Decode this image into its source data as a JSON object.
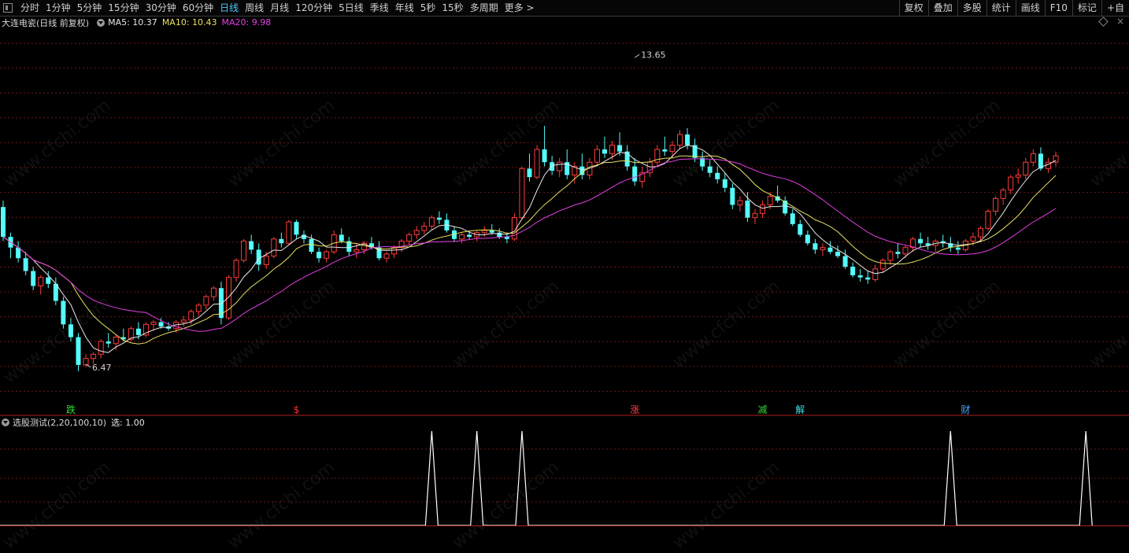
{
  "toolbar": {
    "periods": [
      "分时",
      "1分钟",
      "5分钟",
      "15分钟",
      "30分钟",
      "60分钟",
      "日线",
      "周线",
      "月线",
      "120分钟",
      "5日线",
      "季线",
      "年线",
      "5秒",
      "15秒",
      "多周期",
      "更多 >"
    ],
    "active_period": "日线",
    "right_buttons": [
      "复权",
      "叠加",
      "多股",
      "统计",
      "画线",
      "F10",
      "标记",
      "+自"
    ]
  },
  "main_header": {
    "title": "大连电瓷(日线 前复权)",
    "ma5": "MA5: 10.37",
    "ma10": "MA10: 10.43",
    "ma20": "MA20: 9.98"
  },
  "sub_header": {
    "title": "选股测试(2,20,100,10)",
    "value": "选: 1.00"
  },
  "watermark": "www.cfchi.com",
  "colors": {
    "up": "#ff3c3c",
    "down": "#54fcfc",
    "ma5": "#e8e8e8",
    "ma10": "#e8e060",
    "ma20": "#e040e0",
    "grid": "#6a1818",
    "signal": "#ffffff",
    "background": "#000000",
    "active": "#4ec9ff"
  },
  "chart_data": [
    {
      "type": "candlestick",
      "n": 146,
      "ylim": [
        5.6,
        14.3
      ],
      "annotations": [
        {
          "text": "13.65",
          "index": 84,
          "value": 13.65
        },
        {
          "text": "6.47",
          "index": 11,
          "value": 6.47
        }
      ],
      "markers": [
        {
          "text": "跌",
          "index": 9,
          "color": "#33dd33"
        },
        {
          "text": "$",
          "index": 39,
          "color": "#ff3030"
        },
        {
          "text": "涨",
          "index": 84,
          "color": "#ff4040"
        },
        {
          "text": "减",
          "index": 101,
          "color": "#33dd33"
        },
        {
          "text": "解",
          "index": 106,
          "color": "#40e0e0"
        },
        {
          "text": "财",
          "index": 128,
          "color": "#4aa8ff"
        }
      ],
      "ohlc": [
        [
          10.15,
          10.3,
          9.35,
          9.45
        ],
        [
          9.45,
          9.55,
          8.95,
          9.2
        ],
        [
          9.2,
          9.35,
          8.85,
          8.95
        ],
        [
          8.95,
          9.1,
          8.55,
          8.65
        ],
        [
          8.65,
          8.75,
          8.2,
          8.3
        ],
        [
          8.3,
          8.55,
          8.1,
          8.5
        ],
        [
          8.5,
          8.65,
          8.25,
          8.35
        ],
        [
          8.35,
          8.5,
          7.85,
          7.95
        ],
        [
          7.95,
          8.05,
          7.3,
          7.4
        ],
        [
          7.4,
          7.55,
          7.0,
          7.1
        ],
        [
          7.1,
          7.2,
          6.3,
          6.45
        ],
        [
          6.45,
          6.7,
          6.4,
          6.6
        ],
        [
          6.6,
          6.75,
          6.47,
          6.7
        ],
        [
          6.7,
          7.05,
          6.6,
          7.0
        ],
        [
          7.0,
          7.2,
          6.85,
          6.95
        ],
        [
          6.95,
          7.15,
          6.8,
          7.1
        ],
        [
          7.1,
          7.3,
          7.0,
          7.05
        ],
        [
          7.05,
          7.35,
          7.0,
          7.3
        ],
        [
          7.3,
          7.45,
          7.05,
          7.15
        ],
        [
          7.15,
          7.45,
          7.1,
          7.4
        ],
        [
          7.4,
          7.5,
          7.25,
          7.45
        ],
        [
          7.45,
          7.55,
          7.3,
          7.35
        ],
        [
          7.35,
          7.45,
          7.25,
          7.3
        ],
        [
          7.3,
          7.5,
          7.2,
          7.45
        ],
        [
          7.45,
          7.6,
          7.35,
          7.5
        ],
        [
          7.5,
          7.75,
          7.4,
          7.7
        ],
        [
          7.7,
          7.9,
          7.6,
          7.85
        ],
        [
          7.85,
          8.1,
          7.75,
          8.05
        ],
        [
          8.05,
          8.3,
          7.95,
          8.25
        ],
        [
          8.25,
          8.4,
          7.4,
          7.55
        ],
        [
          7.55,
          8.55,
          7.5,
          8.5
        ],
        [
          8.5,
          8.95,
          8.4,
          8.9
        ],
        [
          8.9,
          9.4,
          8.85,
          9.35
        ],
        [
          9.35,
          9.5,
          9.05,
          9.15
        ],
        [
          9.15,
          9.3,
          8.65,
          8.8
        ],
        [
          8.8,
          9.1,
          8.7,
          9.0
        ],
        [
          9.0,
          9.45,
          8.95,
          9.4
        ],
        [
          9.4,
          9.55,
          9.2,
          9.3
        ],
        [
          9.3,
          9.85,
          9.25,
          9.8
        ],
        [
          9.8,
          9.85,
          9.4,
          9.5
        ],
        [
          9.5,
          9.6,
          9.3,
          9.4
        ],
        [
          9.4,
          9.5,
          9.05,
          9.1
        ],
        [
          9.1,
          9.2,
          8.85,
          8.95
        ],
        [
          8.95,
          9.15,
          8.85,
          9.1
        ],
        [
          9.1,
          9.6,
          9.05,
          9.5
        ],
        [
          9.5,
          9.65,
          9.3,
          9.35
        ],
        [
          9.35,
          9.45,
          9.0,
          9.1
        ],
        [
          9.1,
          9.3,
          8.95,
          9.15
        ],
        [
          9.15,
          9.35,
          9.05,
          9.3
        ],
        [
          9.3,
          9.45,
          9.15,
          9.2
        ],
        [
          9.2,
          9.35,
          8.9,
          8.95
        ],
        [
          8.95,
          9.1,
          8.85,
          9.05
        ],
        [
          9.05,
          9.25,
          8.95,
          9.2
        ],
        [
          9.2,
          9.4,
          9.1,
          9.35
        ],
        [
          9.35,
          9.55,
          9.25,
          9.5
        ],
        [
          9.5,
          9.7,
          9.4,
          9.6
        ],
        [
          9.6,
          9.8,
          9.5,
          9.7
        ],
        [
          9.7,
          9.95,
          9.6,
          9.9
        ],
        [
          9.9,
          10.05,
          9.75,
          9.85
        ],
        [
          9.85,
          10.0,
          9.55,
          9.6
        ],
        [
          9.6,
          9.7,
          9.35,
          9.4
        ],
        [
          9.4,
          9.55,
          9.3,
          9.5
        ],
        [
          9.5,
          9.6,
          9.4,
          9.45
        ],
        [
          9.45,
          9.6,
          9.35,
          9.55
        ],
        [
          9.55,
          9.7,
          9.45,
          9.6
        ],
        [
          9.6,
          9.75,
          9.5,
          9.55
        ],
        [
          9.55,
          9.65,
          9.4,
          9.45
        ],
        [
          9.45,
          9.55,
          9.3,
          9.4
        ],
        [
          9.4,
          10.0,
          9.35,
          9.9
        ],
        [
          9.9,
          11.1,
          9.85,
          11.05
        ],
        [
          11.05,
          11.4,
          10.75,
          10.85
        ],
        [
          10.85,
          11.6,
          10.8,
          11.5
        ],
        [
          11.5,
          12.05,
          11.1,
          11.2
        ],
        [
          11.2,
          11.35,
          10.9,
          11.0
        ],
        [
          11.0,
          11.3,
          10.85,
          11.2
        ],
        [
          11.2,
          11.5,
          10.8,
          10.9
        ],
        [
          10.9,
          11.2,
          10.7,
          11.1
        ],
        [
          11.1,
          11.4,
          10.8,
          10.9
        ],
        [
          10.9,
          11.3,
          10.8,
          11.2
        ],
        [
          11.2,
          11.6,
          11.1,
          11.5
        ],
        [
          11.5,
          11.8,
          11.3,
          11.4
        ],
        [
          11.4,
          11.7,
          11.25,
          11.6
        ],
        [
          11.6,
          11.9,
          11.35,
          11.45
        ],
        [
          11.45,
          11.6,
          11.0,
          11.1
        ],
        [
          11.1,
          11.3,
          10.65,
          10.75
        ],
        [
          10.75,
          11.1,
          10.6,
          10.95
        ],
        [
          10.95,
          11.3,
          10.85,
          11.2
        ],
        [
          11.2,
          11.6,
          11.1,
          11.5
        ],
        [
          11.5,
          11.8,
          11.35,
          11.45
        ],
        [
          11.45,
          11.7,
          11.3,
          11.6
        ],
        [
          11.6,
          11.95,
          11.5,
          11.85
        ],
        [
          11.85,
          12.0,
          11.5,
          11.6
        ],
        [
          11.6,
          11.75,
          11.2,
          11.3
        ],
        [
          11.3,
          11.45,
          11.0,
          11.1
        ],
        [
          11.1,
          11.25,
          10.85,
          10.95
        ],
        [
          10.95,
          11.1,
          10.7,
          10.8
        ],
        [
          10.8,
          10.95,
          10.5,
          10.6
        ],
        [
          10.6,
          10.7,
          10.1,
          10.2
        ],
        [
          10.2,
          10.4,
          10.05,
          10.3
        ],
        [
          10.3,
          10.5,
          9.8,
          9.9
        ],
        [
          9.9,
          10.1,
          9.75,
          10.0
        ],
        [
          10.0,
          10.3,
          9.9,
          10.2
        ],
        [
          10.2,
          10.5,
          10.1,
          10.4
        ],
        [
          10.4,
          10.65,
          10.25,
          10.3
        ],
        [
          10.3,
          10.4,
          9.95,
          10.0
        ],
        [
          10.0,
          10.1,
          9.7,
          9.75
        ],
        [
          9.75,
          9.85,
          9.45,
          9.5
        ],
        [
          9.5,
          9.6,
          9.25,
          9.3
        ],
        [
          9.3,
          9.4,
          9.05,
          9.15
        ],
        [
          9.15,
          9.3,
          9.0,
          9.2
        ],
        [
          9.2,
          9.35,
          9.05,
          9.1
        ],
        [
          9.1,
          9.25,
          8.95,
          9.0
        ],
        [
          9.0,
          9.15,
          8.7,
          8.75
        ],
        [
          8.75,
          8.85,
          8.5,
          8.55
        ],
        [
          8.55,
          8.7,
          8.4,
          8.5
        ],
        [
          8.5,
          8.65,
          8.35,
          8.45
        ],
        [
          8.45,
          8.8,
          8.4,
          8.7
        ],
        [
          8.7,
          8.95,
          8.6,
          8.9
        ],
        [
          8.9,
          9.15,
          8.8,
          9.1
        ],
        [
          9.1,
          9.3,
          8.95,
          9.05
        ],
        [
          9.05,
          9.25,
          8.95,
          9.2
        ],
        [
          9.2,
          9.45,
          9.1,
          9.4
        ],
        [
          9.4,
          9.55,
          9.2,
          9.3
        ],
        [
          9.3,
          9.45,
          9.15,
          9.25
        ],
        [
          9.25,
          9.4,
          9.1,
          9.35
        ],
        [
          9.35,
          9.5,
          9.2,
          9.3
        ],
        [
          9.3,
          9.45,
          9.1,
          9.2
        ],
        [
          9.2,
          9.35,
          9.05,
          9.15
        ],
        [
          9.15,
          9.4,
          9.1,
          9.35
        ],
        [
          9.35,
          9.55,
          9.25,
          9.45
        ],
        [
          9.45,
          9.7,
          9.35,
          9.65
        ],
        [
          9.65,
          10.1,
          9.6,
          10.05
        ],
        [
          10.05,
          10.4,
          9.95,
          10.35
        ],
        [
          10.35,
          10.6,
          10.2,
          10.55
        ],
        [
          10.55,
          10.9,
          10.45,
          10.85
        ],
        [
          10.85,
          11.05,
          10.7,
          10.9
        ],
        [
          10.9,
          11.3,
          10.8,
          11.2
        ],
        [
          11.2,
          11.5,
          11.1,
          11.4
        ],
        [
          11.4,
          11.55,
          11.0,
          11.05
        ],
        [
          11.05,
          11.3,
          10.95,
          11.2
        ],
        [
          11.2,
          11.45,
          11.1,
          11.35
        ]
      ]
    },
    {
      "type": "line",
      "name": "选股测试",
      "ylim": [
        0,
        1
      ],
      "spikes": [
        57,
        63,
        69,
        126,
        144
      ]
    }
  ]
}
